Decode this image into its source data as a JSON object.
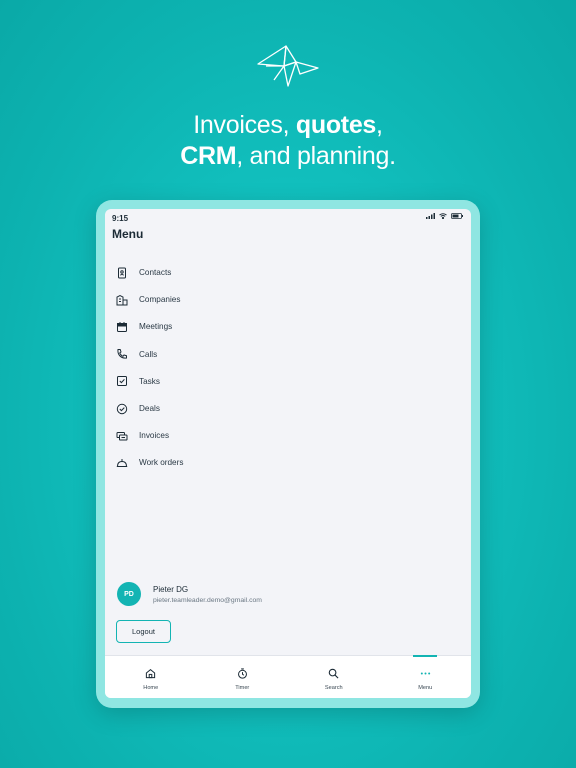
{
  "headline": {
    "line1_regular": "Invoices, ",
    "line1_bold": "quotes",
    "line1_tail": ",",
    "line2_bold": "CRM",
    "line2_regular": ", and planning."
  },
  "status_bar": {
    "time": "9:15"
  },
  "menu": {
    "title": "Menu",
    "items": [
      {
        "label": "Contacts",
        "icon": "contacts-icon"
      },
      {
        "label": "Companies",
        "icon": "companies-icon"
      },
      {
        "label": "Meetings",
        "icon": "calendar-icon"
      },
      {
        "label": "Calls",
        "icon": "phone-icon"
      },
      {
        "label": "Tasks",
        "icon": "checkbox-icon"
      },
      {
        "label": "Deals",
        "icon": "check-circle-icon"
      },
      {
        "label": "Invoices",
        "icon": "invoices-icon"
      },
      {
        "label": "Work orders",
        "icon": "work-orders-icon"
      }
    ]
  },
  "user": {
    "initials": "PD",
    "name": "Pieter DG",
    "email": "pieter.teamleader.demo@gmail.com"
  },
  "logout_label": "Logout",
  "tabs": [
    {
      "label": "Home",
      "icon": "home-icon"
    },
    {
      "label": "Timer",
      "icon": "timer-icon"
    },
    {
      "label": "Search",
      "icon": "search-icon"
    },
    {
      "label": "Menu",
      "icon": "more-icon",
      "active": true
    }
  ],
  "colors": {
    "accent": "#13b4b3",
    "background": "#12c1bf",
    "screen": "#f3f4f8"
  }
}
